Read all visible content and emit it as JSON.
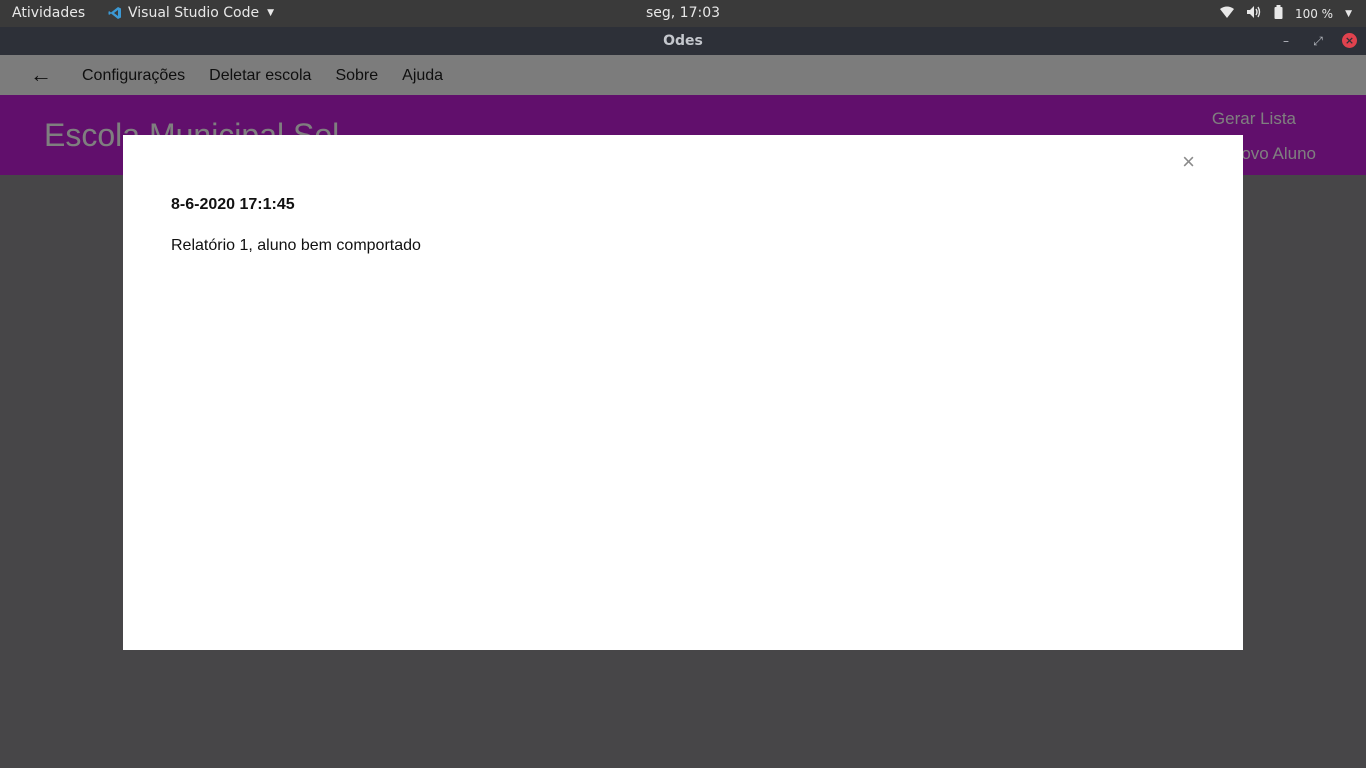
{
  "topbar": {
    "activities": "Atividades",
    "app_name": "Visual Studio Code",
    "clock": "seg, 17:03",
    "battery": "100 %",
    "icons": [
      "wifi-icon",
      "volume-icon",
      "battery-icon",
      "chevron-down-icon"
    ]
  },
  "window": {
    "title": "Odes"
  },
  "menubar": {
    "back": "←",
    "items": [
      "Configurações",
      "Deletar escola",
      "Sobre",
      "Ajuda"
    ]
  },
  "header": {
    "school_name": "Escola Municipal Sol",
    "gerar_lista": "Gerar Lista",
    "novo_aluno": "Novo Aluno",
    "color": "#c31ed8"
  },
  "modal": {
    "close": "×",
    "date": "8-6-2020 17:1:45",
    "text": "Relatório 1, aluno bem comportado"
  }
}
